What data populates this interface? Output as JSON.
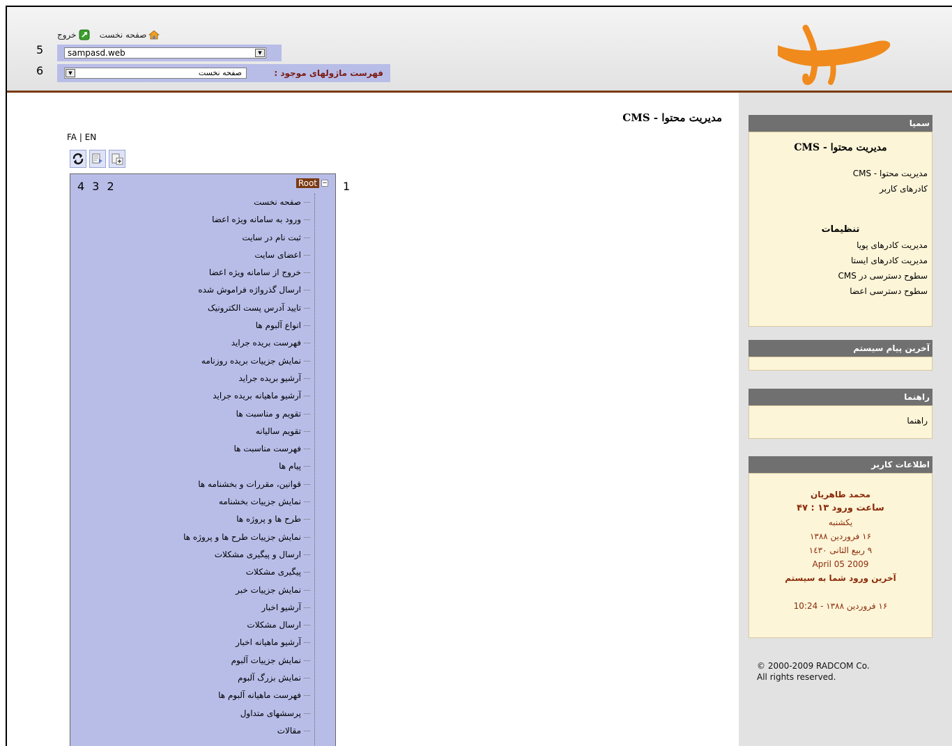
{
  "header": {
    "home_link": "صفحه نخست",
    "logout_link": "خروج",
    "row5_number": "5",
    "row6_number": "6",
    "site_select_value": "sampasd.web",
    "module_list_label": "فهرست ماژولهای موجود :",
    "module_select_value": "صفحه نخست"
  },
  "main": {
    "page_title": "مدیریت محتوا - CMS",
    "lang_fa": "FA",
    "lang_sep": "|",
    "lang_en": "EN",
    "tree_numbers": "4 3 2",
    "label_1": "1",
    "root_label": "Root",
    "tree_items": [
      "صفحه نخست",
      "ورود به سامانه ویژه اعضا",
      "ثبت نام در سایت",
      "اعضای سایت",
      "خروج از سامانه ویژه اعضا",
      "ارسال گذرواژه فراموش شده",
      "تایید آدرس پست الکترونیک",
      "انواع آلبوم ها",
      "فهرست بریده جراید",
      "نمایش جزییات بریده روزنامه",
      "آرشیو بریده جراید",
      "آرشیو ماهیانه بریده جراید",
      "تقویم و مناسبت ها",
      "تقویم سالیانه",
      "فهرست مناسبت ها",
      "پیام ها",
      "قوانین، مقررات و بخشنامه ها",
      "نمایش جزییات بخشنامه",
      "طرح ها و پروژه ها",
      "نمایش جزییات طرح ها و پروژه ها",
      "ارسال و پیگیری مشکلات",
      "پیگیری مشکلات",
      "نمایش جزییات خبر",
      "آرشیو اخبار",
      "ارسال مشکلات",
      "آرشیو ماهیانه اخبار",
      "نمایش جزییات آلبوم",
      "نمایش بزرگ آلبوم",
      "فهرست ماهیانه آلبوم ها",
      "پرسشهای متداول",
      "مقالات"
    ]
  },
  "sidebar": {
    "sampa": {
      "header": "سمپا",
      "title": "مدیریت محتوا - CMS",
      "link1": "مدیریت محتوا - CMS",
      "link2": "کادرهای کاربر",
      "settings_title": "تنظیمات",
      "link3": "مدیریت کادرهای پویا",
      "link4": "مدیریت کادرهای ایستا",
      "link5": "سطوح دسترسی در CMS",
      "link6": "سطوح دسترسی اعضا"
    },
    "system_message": {
      "header": "آخرین پیام سیستم"
    },
    "help": {
      "header": "راهنما",
      "link": "راهنما"
    },
    "user_info": {
      "header": "اطلاعات کاربر",
      "name": "محمد طاهریان",
      "login_time": "ساعت ورود ۱۳ : ۴۷",
      "weekday": "یکشنبه",
      "date_persian": "۱۶ فروردین ۱۳۸۸",
      "date_hijri": "۹ ربیع الثانی ۱٤۳۰",
      "date_gregorian": "2009 05 April",
      "last_login_label": "آخرین ورود شما به سیستم",
      "last_login_value": "۱۶ فروردین ۱۳۸۸ - 10:24"
    },
    "copyright_line1": "© 2000-2009 RADCOM Co.",
    "copyright_line2": "All rights reserved."
  }
}
